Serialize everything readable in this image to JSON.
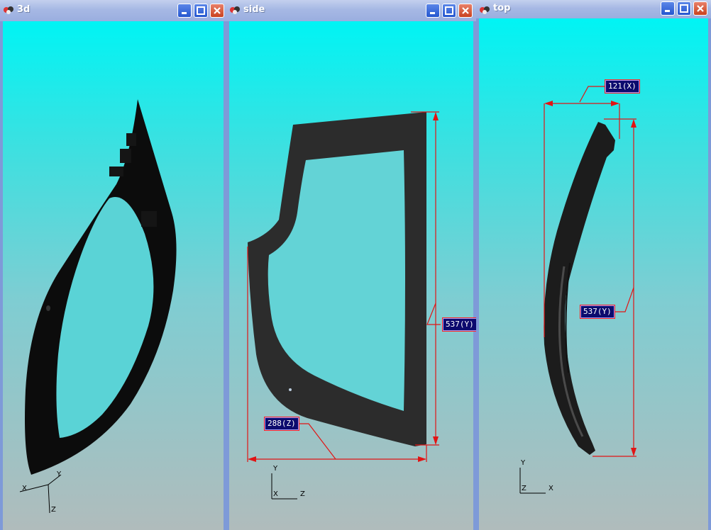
{
  "windows": [
    {
      "title": "3d",
      "axes": {
        "x": "X",
        "y": "Y",
        "z": "Z"
      }
    },
    {
      "title": "side",
      "dims": {
        "height": "537(Y)",
        "width": "288(Z)"
      },
      "axes": {
        "y": "Y",
        "x": "X",
        "z": "Z"
      }
    },
    {
      "title": "top",
      "dims": {
        "width": "121(X)",
        "height": "537(Y)"
      },
      "axes": {
        "y": "Y",
        "z": "Z",
        "x": "X"
      }
    }
  ],
  "controls": {
    "minimize": "minimize",
    "maximize": "maximize",
    "close": "close"
  },
  "colors": {
    "part": "#0d0d0d",
    "dimension_line": "#e11414",
    "label_bg": "#0c0a6e"
  }
}
